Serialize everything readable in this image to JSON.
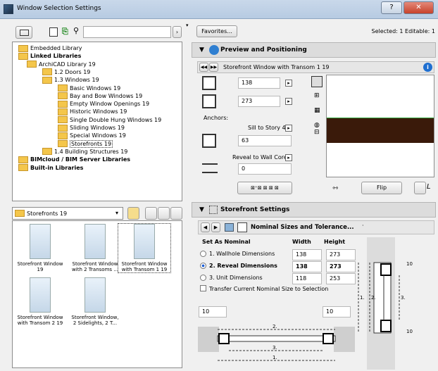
{
  "window": {
    "title": "Window Selection Settings",
    "help_glyph": "?",
    "close_glyph": "✕"
  },
  "toolbar": {
    "search_placeholder": ""
  },
  "tree": [
    {
      "label": "Embedded Library",
      "bold": false
    },
    {
      "label": "Linked Libraries",
      "bold": true
    },
    {
      "label": "ArchiCAD Library 19",
      "bold": false
    },
    {
      "label": "1.2 Doors 19",
      "bold": false
    },
    {
      "label": "1.3 Windows 19",
      "bold": false
    },
    {
      "label": "Basic Windows 19",
      "bold": false
    },
    {
      "label": "Bay and Bow Windows 19",
      "bold": false
    },
    {
      "label": "Empty Window Openings 19",
      "bold": false
    },
    {
      "label": "Historic Windows 19",
      "bold": false
    },
    {
      "label": "Single Double Hung Windows 19",
      "bold": false
    },
    {
      "label": "Sliding Windows 19",
      "bold": false
    },
    {
      "label": "Special Windows 19",
      "bold": false
    },
    {
      "label": "Storefronts 19",
      "bold": false,
      "selected": true
    },
    {
      "label": "1.4 Building Structures 19",
      "bold": false
    },
    {
      "label": "BIMcloud / BIM Server Libraries",
      "bold": true
    },
    {
      "label": "Built-in Libraries",
      "bold": true
    }
  ],
  "folder_dropdown": {
    "value": "Storefronts 19"
  },
  "items": [
    {
      "label1": "Storefront Window",
      "label2": "19"
    },
    {
      "label1": "Storefront Window",
      "label2": "with 2 Transoms ..."
    },
    {
      "label1": "Storefront Window",
      "label2": "with Transom 1 19",
      "selected": true
    },
    {
      "label1": "Storefront Window",
      "label2": "with Transom 2 19"
    },
    {
      "label1": "Storefront Window,",
      "label2": "2 Sidelights, 2 T..."
    }
  ],
  "favorites_label": "Favorites...",
  "selected_info": "Selected: 1 Editable: 1",
  "preview": {
    "title": "Preview and Positioning",
    "object_name": "Storefront Window with Transom 1 19",
    "width": "138",
    "height": "273",
    "anchors_label": "Anchors:",
    "sill_label": "Sill to Story 4",
    "sill_value": "63",
    "reveal_label": "Reveal to Wall Core",
    "reveal_value": "0",
    "flip_label": "Flip",
    "info_glyph": "i"
  },
  "storefront": {
    "title": "Storefront Settings",
    "page_label": "Nominal Sizes and Tolerance...",
    "col_set": "Set As Nominal",
    "col_width": "Width",
    "col_height": "Height",
    "rows": [
      {
        "label": "1. Wallhole Dimensions",
        "width": "138",
        "height": "273",
        "bold": false,
        "checked": false
      },
      {
        "label": "2. Reveal Dimensions",
        "width": "138",
        "height": "273",
        "bold": true,
        "checked": true
      },
      {
        "label": "3. Unit Dimensions",
        "width": "118",
        "height": "253",
        "bold": false,
        "checked": false
      }
    ],
    "transfer_label": "Transfer Current Nominal Size to Selection",
    "tol_left": "10",
    "tol_right": "10",
    "dim2": "2.",
    "dim3": "3.",
    "dim1": "1.",
    "side_top": "10",
    "side_bottom": "10",
    "side_1": "1.",
    "side_2": "2.",
    "side_3": "3."
  }
}
